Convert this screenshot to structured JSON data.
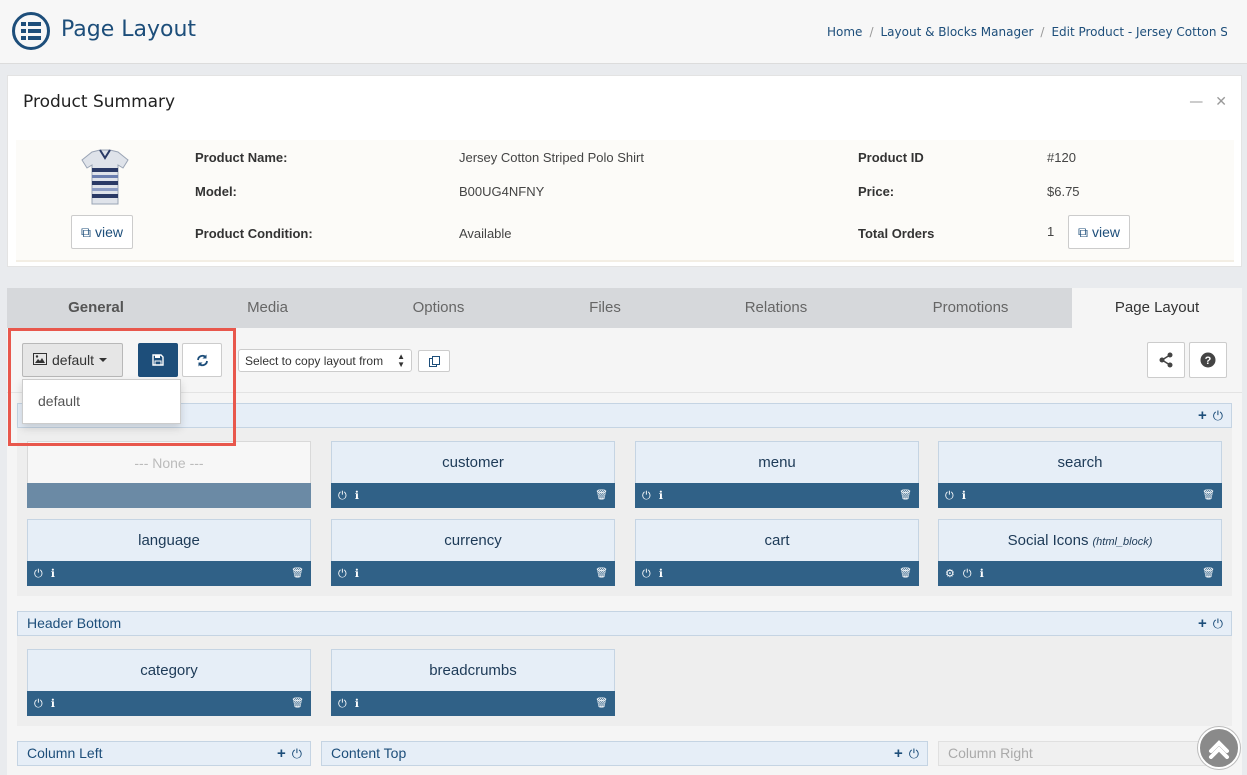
{
  "header": {
    "title": "Page Layout",
    "breadcrumb": [
      "Home",
      "Layout & Blocks Manager",
      "Edit Product - Jersey Cotton Stri"
    ]
  },
  "summary": {
    "title": "Product Summary",
    "view_label": "view",
    "product_name_label": "Product Name:",
    "product_name": "Jersey Cotton Striped Polo Shirt",
    "model_label": "Model:",
    "model": "B00UG4NFNY",
    "condition_label": "Product Condition:",
    "condition": "Available",
    "product_id_label": "Product ID",
    "product_id": "#120",
    "price_label": "Price:",
    "price": "$6.75",
    "orders_label": "Total Orders",
    "orders": "1"
  },
  "tabs": [
    "General",
    "Media",
    "Options",
    "Files",
    "Relations",
    "Promotions",
    "Page Layout"
  ],
  "toolbar": {
    "layout_selected": "default",
    "layout_options": [
      "default"
    ],
    "copy_placeholder": "Select to copy layout from"
  },
  "sections": {
    "header_top": {
      "blocks": [
        {
          "name": "--- None ---"
        },
        {
          "name": "customer"
        },
        {
          "name": "menu"
        },
        {
          "name": "search"
        },
        {
          "name": "language"
        },
        {
          "name": "currency"
        },
        {
          "name": "cart"
        },
        {
          "name": "Social Icons",
          "type": "(html_block)"
        }
      ]
    },
    "header_bottom": {
      "title": "Header Bottom",
      "blocks": [
        {
          "name": "category"
        },
        {
          "name": "breadcrumbs"
        }
      ]
    },
    "column_left": {
      "title": "Column Left"
    },
    "content_top": {
      "title": "Content Top"
    },
    "column_right": {
      "title": "Column Right"
    }
  },
  "colors": {
    "brand": "#1d4e7a",
    "block_bar": "#306187",
    "highlight": "#e8574c"
  }
}
